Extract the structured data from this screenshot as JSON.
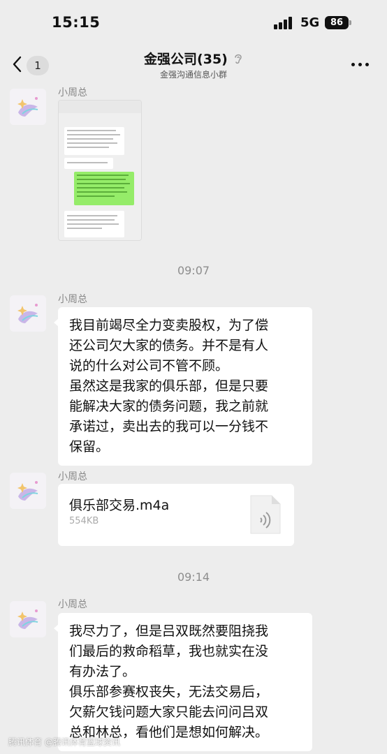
{
  "status_bar": {
    "time": "15:15",
    "network": "5G",
    "battery": "86"
  },
  "nav": {
    "unread_count": "1",
    "title": "金强公司(35)",
    "subtitle": "金强沟通信息小群"
  },
  "messages": [
    {
      "sender": "小周总",
      "type": "image"
    },
    {
      "type": "time",
      "text": "09:07"
    },
    {
      "sender": "小周总",
      "type": "text",
      "lines": [
        "我目前竭尽全力变卖股权，为了偿",
        "还公司欠大家的债务。并不是有人",
        "说的什么对公司不管不顾。",
        "虽然这是我家的俱乐部，但是只要",
        "能解决大家的债务问题，我之前就",
        "承诺过，卖出去的我可以一分钱不",
        "保留。"
      ]
    },
    {
      "sender": "小周总",
      "type": "file",
      "file_name": "俱乐部交易.m4a",
      "file_size": "554KB"
    },
    {
      "type": "time",
      "text": "09:14"
    },
    {
      "sender": "小周总",
      "type": "text",
      "lines": [
        "我尽力了，但是吕双既然要阻挠我",
        "们最后的救命稻草，我也就实在没",
        "有办法了。",
        "俱乐部参赛权丧失，无法交易后，",
        "欠薪欠钱问题大家只能去问问吕双",
        "总和林总，看他们是想如何解决。"
      ]
    }
  ],
  "watermark": "腾讯体育 @腾讯体育篮球资讯",
  "colors": {
    "background": "#ededed",
    "bubble": "#ffffff",
    "wechat_green": "#95ec69"
  },
  "icons": [
    "back-chevron-icon",
    "ear-icon",
    "more-icon",
    "audio-file-icon",
    "avatar-icon"
  ]
}
